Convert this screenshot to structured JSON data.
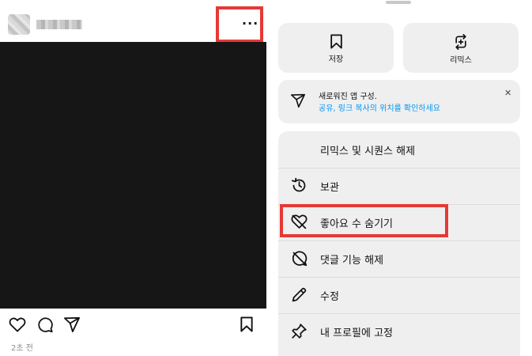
{
  "post": {
    "more_icon": "···",
    "timestamp": "2초 전",
    "icons": [
      "heart-icon",
      "comment-icon",
      "share-icon",
      "bookmark-icon"
    ]
  },
  "sheet": {
    "tiles": [
      {
        "label": "저장",
        "icon": "bookmark-icon"
      },
      {
        "label": "리믹스",
        "icon": "remix-icon"
      }
    ],
    "notice": {
      "title": "새로워진 앱 구성.",
      "description": "공유, 링크 복사의 위치를 확인하세요",
      "close": "✕"
    },
    "menu": [
      {
        "label": "리믹스 및 시퀀스 해제",
        "icon": ""
      },
      {
        "label": "보관",
        "icon": "archive-icon"
      },
      {
        "label": "좋아요 수 숨기기",
        "icon": "hide-likes-icon"
      },
      {
        "label": "댓글 기능 해제",
        "icon": "comments-off-icon"
      },
      {
        "label": "수정",
        "icon": "edit-icon"
      },
      {
        "label": "내 프로필에 고정",
        "icon": "pin-icon"
      }
    ]
  },
  "colors": {
    "highlight": "#e53935",
    "link": "#0095f6",
    "sheet_bg": "#efefef"
  }
}
